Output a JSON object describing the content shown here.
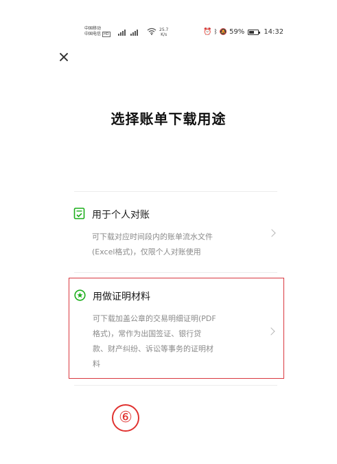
{
  "status_bar": {
    "carrier_1": "中国移动",
    "carrier_2": "中国电信",
    "carrier_badge": "HD",
    "network_speed": "25.7",
    "network_speed_unit": "K/s",
    "battery_percent": "59%",
    "battery_level": 0.59,
    "time": "14:32"
  },
  "header": {
    "close_icon": "close-icon",
    "title": "选择账单下载用途"
  },
  "options": [
    {
      "icon": "document-check-icon",
      "title": "用于个人对账",
      "description_lines": [
        "可下载对应时间段内的账单流水文件",
        "(Excel格式)，仅限个人对账使用"
      ]
    },
    {
      "icon": "star-badge-icon",
      "title": "用做证明材料",
      "description_lines": [
        "可下载加盖公章的交易明细证明(PDF",
        "格式)，常作为出国签证、银行贷",
        "款、财产纠纷、诉讼等事务的证明材",
        "料"
      ]
    }
  ],
  "annotation": {
    "step_marker": "⑥"
  },
  "colors": {
    "accent_green": "#1aad19",
    "highlight_red": "#d9363e",
    "text_primary": "#1a1a1a",
    "text_secondary": "#8a8a8a"
  }
}
